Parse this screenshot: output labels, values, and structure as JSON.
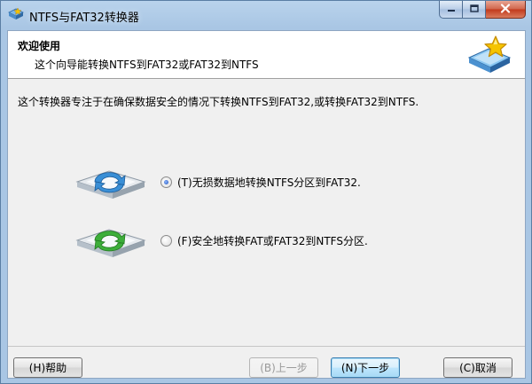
{
  "window": {
    "title": "NTFS与FAT32转换器"
  },
  "header": {
    "title": "欢迎使用",
    "subtitle": "这个向导能转换NTFS到FAT32或FAT32到NTFS"
  },
  "description": "这个转换器专注于在确保数据安全的情况下转换NTFS到FAT32,或转换FAT32到NTFS.",
  "options": [
    {
      "label": "(T)无损数据地转换NTFS分区到FAT32.",
      "checked": true,
      "arrow_color": "#3a8fd6"
    },
    {
      "label": "(F)安全地转换FAT或FAT32到NTFS分区.",
      "checked": false,
      "arrow_color": "#3dae3a"
    }
  ],
  "buttons": {
    "help": "(H)帮助",
    "back": "(B)上一步",
    "next": "(N)下一步",
    "cancel": "(C)取消"
  },
  "window_controls": {
    "minimize_icon": "minimize-icon",
    "maximize_icon": "maximize-icon",
    "close_icon": "close-icon"
  },
  "colors": {
    "titlebar": "#a9c6e4",
    "close_button": "#c2391c",
    "star": "#f5c400"
  }
}
